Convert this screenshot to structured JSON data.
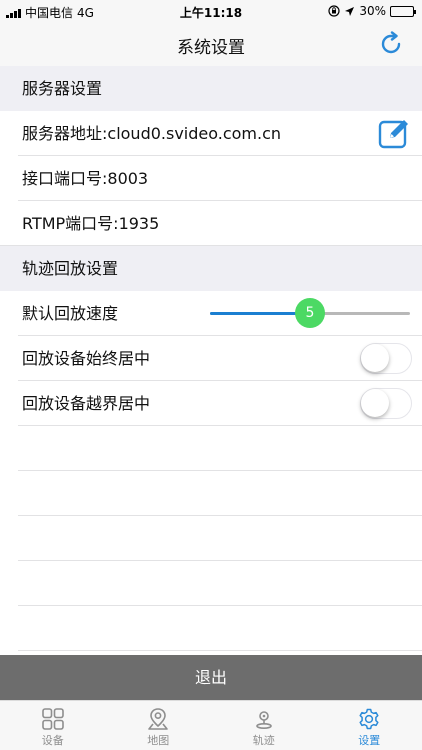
{
  "status_bar": {
    "carrier": "中国电信",
    "network": "4G",
    "time": "上午11:18",
    "battery_percent": "30%",
    "battery_level": 0.3
  },
  "header": {
    "title": "系统设置",
    "refresh_icon": "refresh-icon"
  },
  "server_section": {
    "title": "服务器设置",
    "address": "服务器地址:cloud0.svideo.com.cn",
    "edit_icon": "edit-icon",
    "api_port": "接口端口号:8003",
    "rtmp_port": "RTMP端口号:1935"
  },
  "playback_section": {
    "title": "轨迹回放设置",
    "speed_label": "默认回放速度",
    "speed_value": "5",
    "speed_fraction": 0.5,
    "always_center_label": "回放设备始终居中",
    "always_center_on": false,
    "out_of_bounds_center_label": "回放设备越界居中",
    "out_of_bounds_center_on": false
  },
  "logout_label": "退出",
  "tabs": [
    {
      "label": "设备",
      "icon": "grid-icon",
      "active": false
    },
    {
      "label": "地图",
      "icon": "map-pin-icon",
      "active": false
    },
    {
      "label": "轨迹",
      "icon": "track-icon",
      "active": false
    },
    {
      "label": "设置",
      "icon": "gear-icon",
      "active": true
    }
  ],
  "colors": {
    "accent": "#2b8ad8",
    "slider_thumb": "#4cd964",
    "logout_bg": "#6d6d6d",
    "section_bg": "#efeff4"
  }
}
